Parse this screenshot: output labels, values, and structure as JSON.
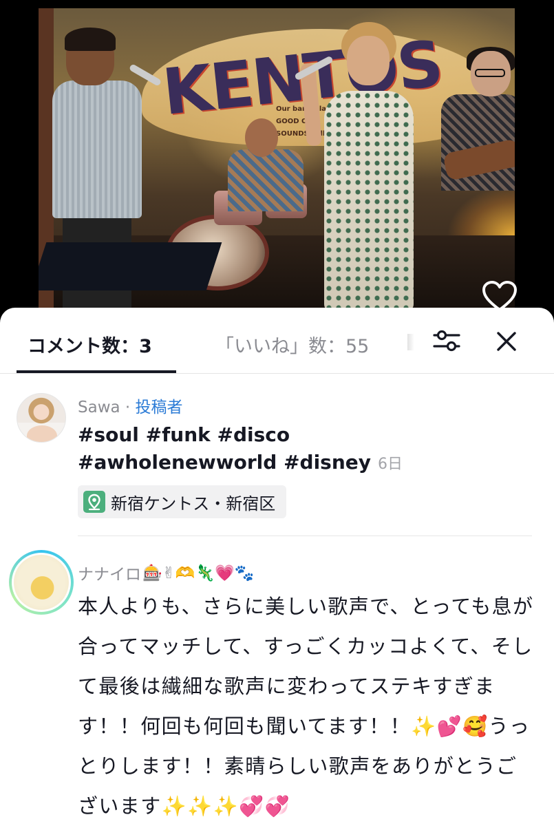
{
  "video": {
    "venue_sign": "KENTOS",
    "venue_sign_sub": "Our band play GOOD OLD SOUNDS Follow"
  },
  "tabs": {
    "comments_label": "コメント数：3",
    "likes_label": "「いいね」数：55"
  },
  "icons": {
    "like": "heart-icon",
    "filter": "sliders-icon",
    "close": "close-icon",
    "location": "location-pin-icon"
  },
  "colors": {
    "author_tag": "#2b7bd6",
    "location_pin": "#4caf7d",
    "avatar_ring": "#35c3f0"
  },
  "comments": [
    {
      "username": "Sawa",
      "separator": " · ",
      "author_tag": "投稿者",
      "text": "#soul #funk #disco #awholenewworld #disney",
      "date": "6日",
      "location": "新宿ケントス・新宿区"
    },
    {
      "username": "ナナイロ",
      "username_emoji": "🎰✌🫶🦎💗🐾",
      "text": "本人よりも、さらに美しい歌声で、とっても息が合ってマッチして、すっごくカッコよくて、そして最後は繊細な歌声に変わってステキすぎます！！何回も何回も聞いてます！！✨💕🥰うっとりします！！素晴らしい歌声をありがとうございます✨✨✨💞💞"
    }
  ]
}
